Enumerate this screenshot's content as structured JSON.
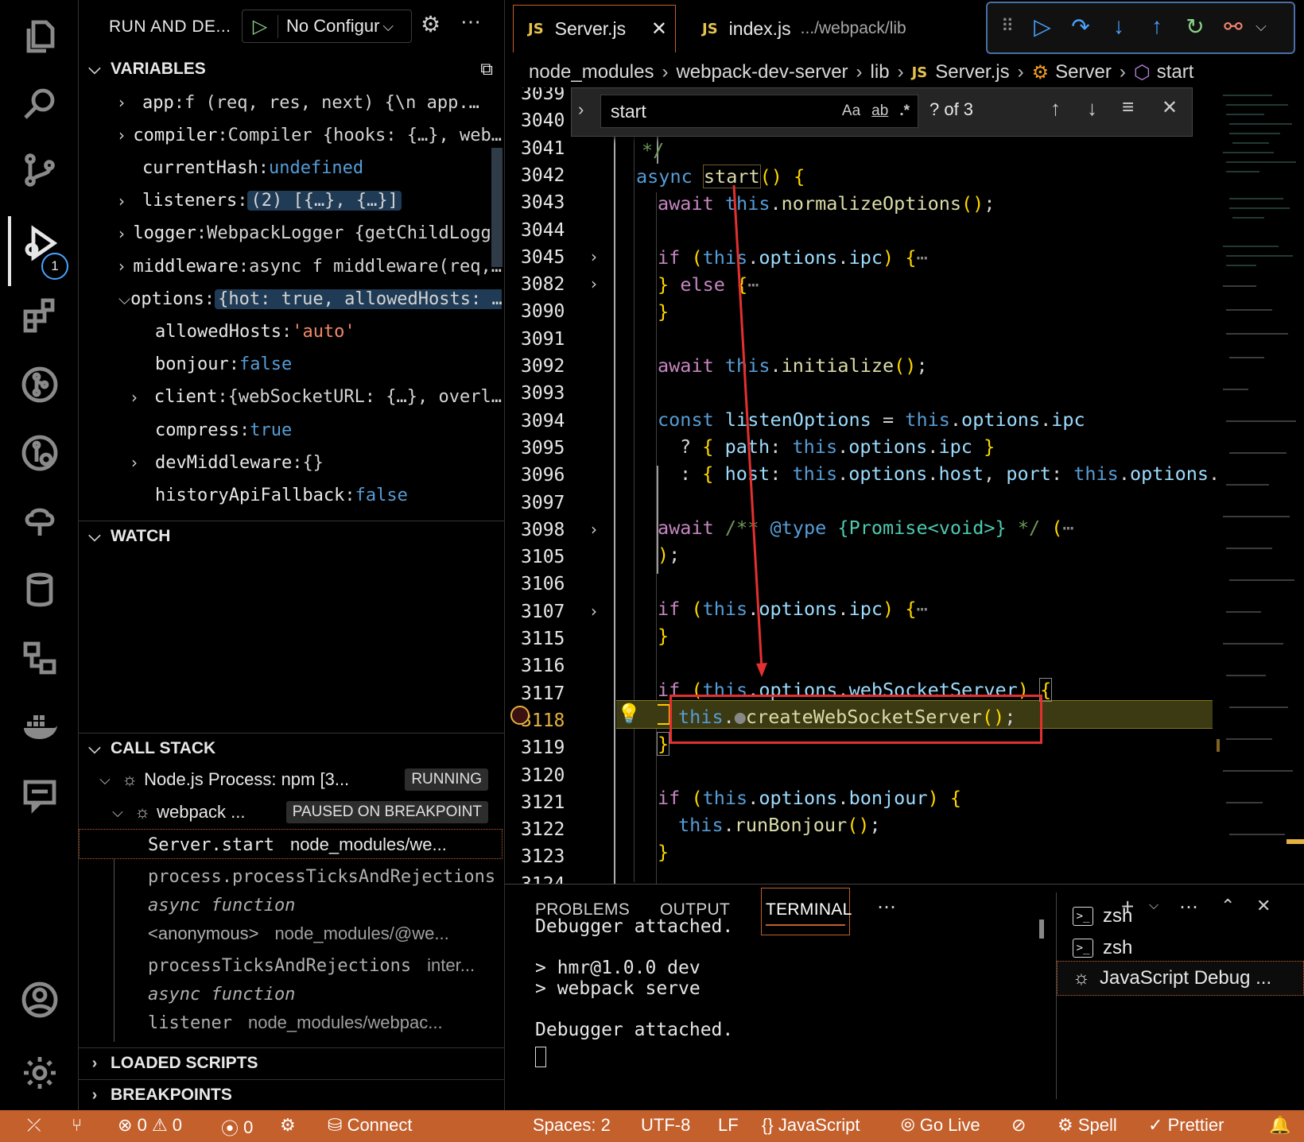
{
  "sidebar": {
    "title": "RUN AND DE...",
    "config": "No Configur",
    "variables_title": "VARIABLES",
    "variables": [
      {
        "indent": 0,
        "twisty": ">",
        "key": "app",
        "value": "f (req, res, next) {\\n     app.…"
      },
      {
        "indent": 0,
        "twisty": ">",
        "key": "compiler",
        "value": "Compiler {hooks: {…}, web…"
      },
      {
        "indent": 0,
        "twisty": "",
        "key": "currentHash",
        "value": "undefined"
      },
      {
        "indent": 0,
        "twisty": ">",
        "key": "listeners",
        "value": "(2) [{…}, {…}]"
      },
      {
        "indent": 0,
        "twisty": ">",
        "key": "logger",
        "value": "WebpackLogger {getChildLogg…"
      },
      {
        "indent": 0,
        "twisty": ">",
        "key": "middleware",
        "value": "async f middleware(req,…"
      },
      {
        "indent": 0,
        "twisty": "v",
        "key": "options",
        "value": "{hot: true, allowedHosts: …"
      },
      {
        "indent": 1,
        "twisty": "",
        "key": "allowedHosts",
        "value": "'auto'"
      },
      {
        "indent": 1,
        "twisty": "",
        "key": "bonjour",
        "value": "false"
      },
      {
        "indent": 1,
        "twisty": ">",
        "key": "client",
        "value": "{webSocketURL: {…}, overl…"
      },
      {
        "indent": 1,
        "twisty": "",
        "key": "compress",
        "value": "true"
      },
      {
        "indent": 1,
        "twisty": ">",
        "key": "devMiddleware",
        "value": "{}"
      },
      {
        "indent": 1,
        "twisty": "",
        "key": "historyApiFallback",
        "value": "false"
      }
    ],
    "watch_title": "WATCH",
    "callstack_title": "CALL STACK",
    "process": "Node.js Process: npm [3...",
    "process_status": "RUNNING",
    "thread": "webpack ...",
    "thread_status": "PAUSED ON BREAKPOINT",
    "frames": [
      {
        "name": "Server.start",
        "loc": "node_modules/we..."
      },
      {
        "name": "process.processTicksAndRejections",
        "loc": ""
      },
      {
        "name": "async function",
        "loc": ""
      },
      {
        "name": "<anonymous>",
        "loc": "node_modules/@we..."
      },
      {
        "name": "processTicksAndRejections",
        "loc": "inter..."
      },
      {
        "name": "async function",
        "loc": ""
      },
      {
        "name": "listener",
        "loc": "node_modules/webpac..."
      }
    ],
    "loaded_scripts_title": "LOADED SCRIPTS",
    "breakpoints_title": "BREAKPOINTS"
  },
  "activity": {
    "debug_badge": "1"
  },
  "tabs": [
    {
      "label": "Server.js",
      "lang": "JS",
      "desc": ""
    },
    {
      "label": "index.js",
      "lang": "JS",
      "desc": ".../webpack/lib"
    }
  ],
  "breadcrumbs": [
    "node_modules",
    "webpack-dev-server",
    "lib",
    "Server.js",
    "Server",
    "start"
  ],
  "find": {
    "query": "start",
    "opt_case": "Aa",
    "opt_word": "ab",
    "opt_regex": ".*",
    "result": "? of 3"
  },
  "editor": {
    "line_numbers": [
      "3039",
      "3040",
      "3041",
      "3042",
      "3043",
      "3044",
      "3045",
      "3082",
      "3090",
      "3091",
      "3092",
      "3093",
      "3094",
      "3095",
      "3096",
      "3097",
      "3098",
      "3105",
      "3106",
      "3107",
      "3115",
      "3116",
      "3117",
      "3118",
      "3119",
      "3120",
      "3121",
      "3122",
      "3123",
      "3124"
    ],
    "folded_lines": [
      "3045",
      "3082",
      "3098",
      "3107"
    ],
    "breakpoint_line": "3118"
  },
  "panel": {
    "tabs": [
      "PROBLEMS",
      "OUTPUT",
      "TERMINAL"
    ],
    "active_tab": "TERMINAL",
    "terminal_lines": [
      "Debugger attached.",
      "",
      "> hmr@1.0.0 dev",
      "> webpack serve",
      "",
      "Debugger attached."
    ],
    "terminals": [
      "zsh",
      "zsh",
      "JavaScript Debug ..."
    ]
  },
  "status": {
    "errors": "0",
    "warnings": "0",
    "ports": "0",
    "connect": "Connect",
    "spaces": "Spaces: 2",
    "encoding": "UTF-8",
    "eol": "LF",
    "language": "JavaScript",
    "golive": "Go Live",
    "spell": "Spell",
    "prettier": "Prettier"
  },
  "colors": {
    "status_bar": "#c3602c",
    "accent_blue": "#4aa3ff",
    "current_line": "#3b3a12",
    "annotation_red": "#e33030"
  }
}
